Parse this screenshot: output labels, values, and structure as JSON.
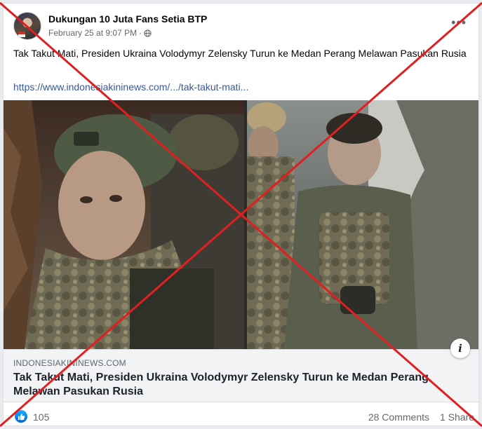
{
  "post": {
    "page_name": "Dukungan 10 Juta Fans Setia BTP",
    "timestamp": "February 25 at 9:07 PM",
    "separator": "·",
    "text": "Tak Takut Mati, Presiden Ukraina Volodymyr Zelensky Turun ke Medan Perang Melawan Pasukan Rusia",
    "link": "https://www.indonesiakininews.com/.../tak-takut-mati...",
    "more_icon": "•••"
  },
  "preview": {
    "domain": "INDONESIAKININEWS.COM",
    "title": "Tak Takut Mati, Presiden Ukraina Volodymyr Zelensky Turun ke Medan Perang Melawan Pasukan Rusia",
    "info_icon": "i"
  },
  "footer": {
    "likes": "105",
    "comments": "28 Comments",
    "shares": "1 Share"
  },
  "colors": {
    "link": "#385898",
    "cross": "#e02020",
    "like_blue": "#1877f2"
  },
  "icons": [
    "globe-icon",
    "more-options-icon",
    "info-icon",
    "like-icon"
  ]
}
